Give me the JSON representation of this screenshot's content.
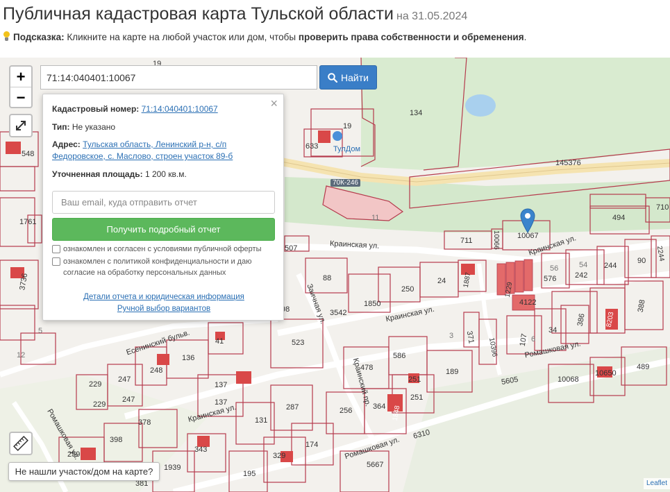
{
  "header": {
    "title": "Публичная кадастровая карта Тульской области",
    "date": "на 31.05.2024",
    "hint_label": "Подсказка:",
    "hint_text": "Кликните на карте на любой участок или дом, чтобы",
    "hint_bold": "проверить права собственности и обременения",
    "hint_end": "."
  },
  "search": {
    "value": "71:14:040401:10067",
    "button_label": "Найти"
  },
  "zoom": {
    "in": "+",
    "out": "−"
  },
  "popup": {
    "close": "×",
    "cadastral_label": "Кадастровый номер:",
    "cadastral_value": "71:14:040401:10067",
    "type_label": "Тип:",
    "type_value": "Не указано",
    "address_label": "Адрес:",
    "address_line1": "Тульская область, Ленинский р-н, с/п",
    "address_line2": "Федоровское, с. Маслово, строен участок 89-б",
    "area_label": "Уточненная площадь:",
    "area_value": "1 200 кв.м.",
    "email_placeholder": "Ваш email, куда отправить отчет",
    "report_button": "Получить подробный отчет",
    "consent1": "ознакомлен и согласен с условиями публичной оферты",
    "consent2_line1": "ознакомлен с политикой конфиденциальности и даю",
    "consent2_line2": "согласие на обработку персональных данных",
    "link_details": "Детали отчета и юридическая информация",
    "link_manual": "Ручной выбор вариантов"
  },
  "map_labels": {
    "l19": "19",
    "l134": "134",
    "l633": "633",
    "l19b": "19",
    "tuldom": "ТулДом",
    "l145376": "145376",
    "road": "70К-246",
    "l11": "11",
    "l494": "494",
    "l710": "710",
    "l711": "711",
    "l10066": "10066",
    "l10067": "10067",
    "krainskaya1": "Краинская ул.",
    "krainskaya2": "Краинская ул.",
    "krainskaya3": "Краинская ул.",
    "krainskaya4": "Краинская ул.",
    "l507": "507",
    "l88": "88",
    "l250": "250",
    "l24": "24",
    "l1887": "1887",
    "l576": "576",
    "l56": "56",
    "l54": "54",
    "l242": "242",
    "l244": "244",
    "l90": "90",
    "l2244": "2244",
    "l1850": "1850",
    "l3542": "3542",
    "l98": "98",
    "l1229": "1229",
    "l4122": "4122",
    "l386": "386",
    "l388": "388",
    "l8203": "8203",
    "l107": "107",
    "l6": "6",
    "l34": "34",
    "l371": "371",
    "l10396": "10396",
    "l523": "523",
    "l41": "41",
    "l136": "136",
    "l248": "248",
    "l247": "247",
    "l229": "229",
    "l229b": "229",
    "l247b": "247",
    "l378": "378",
    "l137": "137",
    "l137b": "137",
    "l478": "478",
    "l586": "586",
    "l189": "189",
    "l251": "251",
    "l251b": "251",
    "l287": "287",
    "l131": "131",
    "l256": "256",
    "l364": "364",
    "l1848": "1848",
    "l174": "174",
    "l329": "329",
    "l343": "343",
    "l398": "398",
    "l259": "259",
    "l1939": "1939",
    "l195": "195",
    "l381": "381",
    "l5667": "5667",
    "l6310": "6310",
    "l5605": "5605",
    "l10068": "10068",
    "l10650": "10650",
    "l489": "489",
    "l1761": "1761",
    "l3736": "3736",
    "l548": "548",
    "l5": "5",
    "l12": "12",
    "l3": "3",
    "esen": "Есенинский бульв.",
    "krainsk_v": "Краинский пр.",
    "romash1": "Ромашковая ул.",
    "romash2": "Ромашковая ул.",
    "romash3": "Ромашковая ул.",
    "zaichik": "Заичная ул."
  },
  "bottom": {
    "not_found": "Не нашли участок/дом на карте?",
    "leaflet": "Leaflet"
  }
}
